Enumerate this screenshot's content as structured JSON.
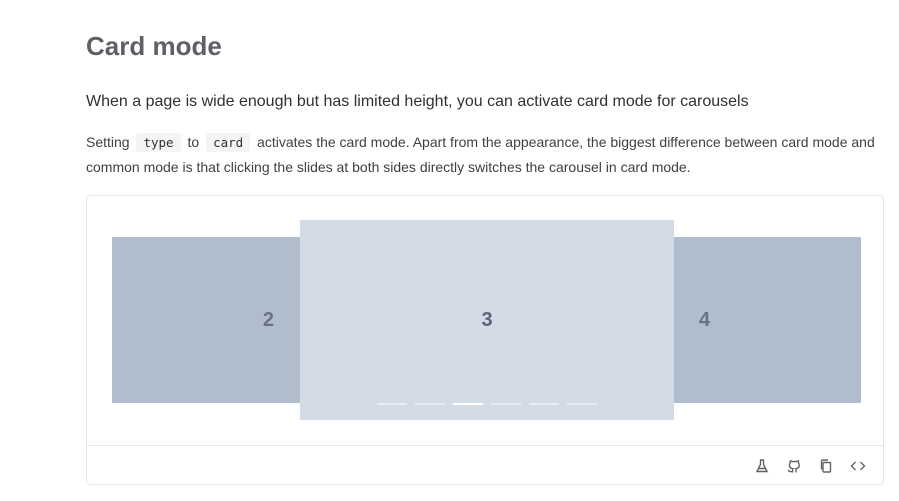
{
  "section": {
    "title": "Card mode",
    "lead": "When a page is wide enough but has limited height, you can activate card mode for carousels",
    "desc_part1": "Setting",
    "code_type": "type",
    "desc_part2": "to",
    "code_card": "card",
    "desc_part3": "activates the card mode. Apart from the appearance, the biggest difference between card mode and common mode is that clicking the slides at both sides directly switches the carousel in card mode."
  },
  "carousel": {
    "slides": {
      "left": "2",
      "active": "3",
      "right": "4"
    },
    "indicator_count": 6,
    "active_indicator": 3,
    "colors": {
      "side_slide": "#afbdcc",
      "active_slide": "#d3dbe6",
      "indicator": "#ffffff"
    }
  },
  "toolbar": {
    "icons": [
      "flask-icon",
      "github-icon",
      "copy-icon",
      "code-icon"
    ]
  }
}
